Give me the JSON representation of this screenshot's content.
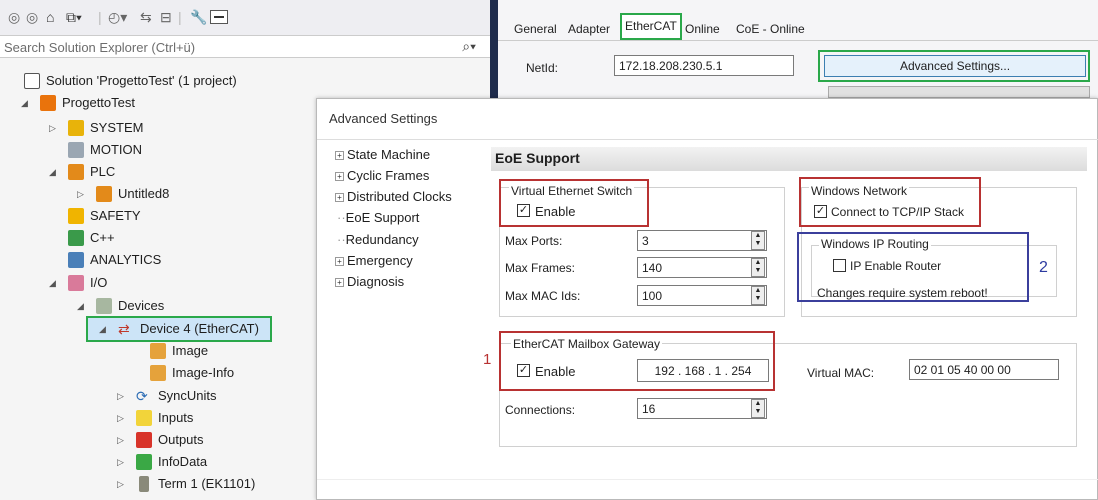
{
  "search": {
    "placeholder": "Search Solution Explorer (Ctrl+ü)"
  },
  "tree": {
    "solution": "Solution 'ProgettoTest' (1 project)",
    "project": "ProgettoTest",
    "system": "SYSTEM",
    "motion": "MOTION",
    "plc": "PLC",
    "untitled": "Untitled8",
    "safety": "SAFETY",
    "cpp": "C++",
    "analytics": "ANALYTICS",
    "io": "I/O",
    "devices": "Devices",
    "device4": "Device 4 (EtherCAT)",
    "image": "Image",
    "image_info": "Image-Info",
    "syncunits": "SyncUnits",
    "inputs": "Inputs",
    "outputs": "Outputs",
    "infodata": "InfoData",
    "term1": "Term 1 (EK1101)"
  },
  "tabs": [
    "General",
    "Adapter",
    "EtherCAT",
    "Online",
    "CoE - Online"
  ],
  "netid": {
    "label": "NetId:",
    "value": "172.18.208.230.5.1"
  },
  "advanced_button": "Advanced Settings...",
  "dialog": {
    "title": "Advanced Settings",
    "nav": [
      "State Machine",
      "Cyclic Frames",
      "Distributed Clocks",
      "EoE Support",
      "Redundancy",
      "Emergency",
      "Diagnosis"
    ],
    "section": "EoE Support",
    "ves": {
      "title": "Virtual Ethernet Switch",
      "enable": "Enable",
      "max_ports_label": "Max Ports:",
      "max_ports": "3",
      "max_frames_label": "Max Frames:",
      "max_frames": "140",
      "max_mac_label": "Max MAC Ids:",
      "max_mac": "100"
    },
    "winnet": {
      "title": "Windows Network",
      "connect": "Connect to TCP/IP Stack"
    },
    "winip": {
      "title": "Windows IP Routing",
      "enable_router": "IP Enable Router",
      "note": "Changes require system reboot!"
    },
    "gateway": {
      "title": "EtherCAT Mailbox Gateway",
      "enable": "Enable",
      "ip": "192 . 168 .  1  . 254",
      "vmac_label": "Virtual MAC:",
      "vmac": "02 01 05 40 00 00",
      "connections_label": "Connections:",
      "connections": "16"
    }
  },
  "markers": {
    "one": "1",
    "two": "2"
  },
  "colors": {
    "green_highlight": "#2aa84a",
    "red_box": "#b83232",
    "blue_box": "#3b3f9c",
    "selection": "#cce4f7"
  }
}
